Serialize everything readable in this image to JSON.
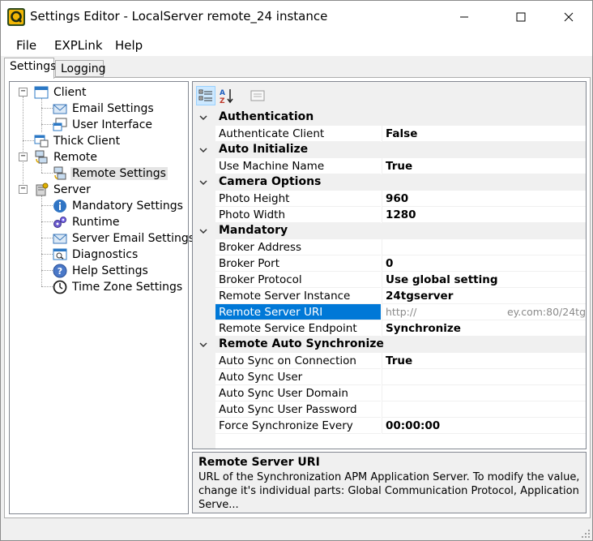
{
  "window": {
    "title": "Settings Editor - LocalServer remote_24 instance",
    "icon": "q-logo-icon"
  },
  "menu": {
    "items": [
      "File",
      "EXPLink",
      "Help"
    ]
  },
  "tabs": [
    {
      "label": "Settings",
      "active": true
    },
    {
      "label": "Logging",
      "active": false
    }
  ],
  "tree": {
    "client": "Client",
    "email_settings": "Email Settings",
    "user_interface": "User Interface",
    "thick_client": "Thick Client",
    "remote": "Remote",
    "remote_settings": "Remote Settings",
    "server": "Server",
    "mandatory_settings": "Mandatory Settings",
    "runtime": "Runtime",
    "server_email_settings": "Server Email Settings",
    "diagnostics": "Diagnostics",
    "help_settings": "Help Settings",
    "time_zone_settings": "Time Zone Settings",
    "selected": "Remote Settings"
  },
  "toolbar": {
    "categorized": "categorized-icon",
    "alphabetical": "sort-az-icon",
    "property_pages": "property-pages-icon"
  },
  "grid": {
    "authentication": "Authentication",
    "authenticate_client": {
      "name": "Authenticate Client",
      "value": "False"
    },
    "auto_initialize": "Auto Initialize",
    "use_machine_name": {
      "name": "Use Machine Name",
      "value": "True"
    },
    "camera_options": "Camera Options",
    "photo_height": {
      "name": "Photo Height",
      "value": "960"
    },
    "photo_width": {
      "name": "Photo Width",
      "value": "1280"
    },
    "mandatory": "Mandatory",
    "broker_address": {
      "name": "Broker Address",
      "value": ""
    },
    "broker_port": {
      "name": "Broker Port",
      "value": "0"
    },
    "broker_protocol": {
      "name": "Broker Protocol",
      "value": "Use global setting"
    },
    "remote_server_instance": {
      "name": "Remote Server Instance",
      "value": "24tgserver"
    },
    "remote_server_uri": {
      "name": "Remote Server URI",
      "value_start": "http://",
      "value_end": "ey.com:80/24tg"
    },
    "remote_service_endpoint": {
      "name": "Remote Service Endpoint",
      "value": "Synchronize"
    },
    "remote_auto_synchronize": "Remote Auto Synchronize",
    "auto_sync_on_connection": {
      "name": "Auto Sync on Connection",
      "value": "True"
    },
    "auto_sync_user": {
      "name": "Auto Sync User",
      "value": ""
    },
    "auto_sync_user_domain": {
      "name": "Auto Sync User Domain",
      "value": ""
    },
    "auto_sync_user_password": {
      "name": "Auto Sync User Password",
      "value": ""
    },
    "force_synchronize_every": {
      "name": "Force Synchronize Every",
      "value": "00:00:00"
    },
    "selected": "Remote Server URI"
  },
  "description": {
    "title": "Remote Server URI",
    "text_line1": "URL of the Synchronization APM Application Server. To modify the value,",
    "text_line2": "change it's individual parts: Global Communication Protocol, Application Serve..."
  },
  "colors": {
    "selection": "#0078d7",
    "chrome": "#f0f0f0",
    "border": "#828790"
  }
}
